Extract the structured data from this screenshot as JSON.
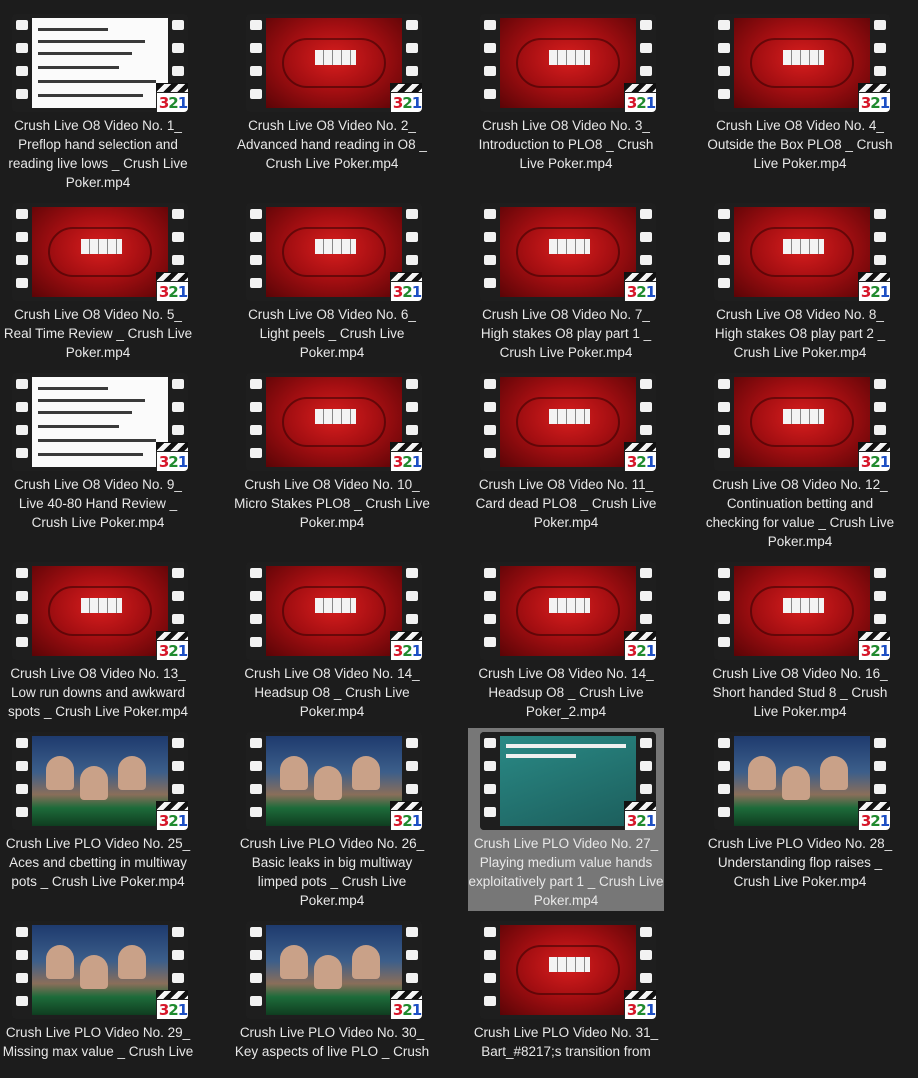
{
  "window": {
    "title": ""
  },
  "badge_text": [
    "3",
    "2",
    "1"
  ],
  "colors": {
    "background": "#1c1c1c",
    "selection": "#777777",
    "label_text": "#e8e8e8",
    "poker_felt": "#b4121a"
  },
  "files": [
    {
      "name": "Crush Live O8 Video No. 1_ Preflop hand selection and reading live lows _ Crush Live Poker.mp4",
      "thumb": "doc",
      "icon": "video-file-icon",
      "selected": false
    },
    {
      "name": "Crush Live O8 Video No. 2_ Advanced hand reading in O8 _ Crush Live Poker.mp4",
      "thumb": "poker",
      "icon": "video-file-icon",
      "selected": false
    },
    {
      "name": "Crush Live O8 Video No. 3_ Introduction to PLO8 _ Crush Live Poker.mp4",
      "thumb": "poker",
      "icon": "video-file-icon",
      "selected": false
    },
    {
      "name": "Crush Live O8 Video No. 4_ Outside the Box PLO8 _ Crush Live Poker.mp4",
      "thumb": "poker",
      "icon": "video-file-icon",
      "selected": false
    },
    {
      "name": "Crush Live O8 Video No. 5_ Real Time Review _ Crush Live Poker.mp4",
      "thumb": "poker",
      "icon": "video-file-icon",
      "selected": false
    },
    {
      "name": "Crush Live O8 Video No. 6_ Light peels _ Crush Live Poker.mp4",
      "thumb": "poker",
      "icon": "video-file-icon",
      "selected": false
    },
    {
      "name": "Crush Live O8 Video No. 7_ High stakes O8 play part 1 _ Crush Live Poker.mp4",
      "thumb": "poker",
      "icon": "video-file-icon",
      "selected": false
    },
    {
      "name": "Crush Live O8 Video No. 8_ High stakes O8 play part 2 _ Crush Live Poker.mp4",
      "thumb": "poker",
      "icon": "video-file-icon",
      "selected": false
    },
    {
      "name": "Crush Live O8 Video No. 9_ Live 40-80 Hand Review _ Crush Live Poker.mp4",
      "thumb": "doc",
      "icon": "video-file-icon",
      "selected": false
    },
    {
      "name": "Crush Live O8 Video No. 10_ Micro Stakes PLO8 _ Crush Live Poker.mp4",
      "thumb": "poker",
      "icon": "video-file-icon",
      "selected": false
    },
    {
      "name": "Crush Live O8 Video No. 11_ Card dead PLO8 _ Crush Live Poker.mp4",
      "thumb": "poker",
      "icon": "video-file-icon",
      "selected": false
    },
    {
      "name": "Crush Live O8 Video No. 12_ Continuation betting and checking for value _ Crush Live Poker.mp4",
      "thumb": "poker",
      "icon": "video-file-icon",
      "selected": false
    },
    {
      "name": "Crush Live O8 Video No. 13_ Low run downs and awkward spots _ Crush Live Poker.mp4",
      "thumb": "poker",
      "icon": "video-file-icon",
      "selected": false
    },
    {
      "name": "Crush Live O8 Video No. 14_ Headsup O8 _ Crush Live Poker.mp4",
      "thumb": "poker",
      "icon": "video-file-icon",
      "selected": false
    },
    {
      "name": "Crush Live O8 Video No. 14_ Headsup O8 _ Crush Live Poker_2.mp4",
      "thumb": "poker",
      "icon": "video-file-icon",
      "selected": false
    },
    {
      "name": "Crush Live O8 Video No. 16_ Short handed Stud 8 _ Crush Live Poker.mp4",
      "thumb": "poker",
      "icon": "video-file-icon",
      "selected": false
    },
    {
      "name": "Crush Live PLO Video No. 25_ Aces and cbetting in multiway pots _ Crush Live Poker.mp4",
      "thumb": "live",
      "icon": "video-file-icon",
      "selected": false
    },
    {
      "name": "Crush Live PLO Video No. 26_ Basic leaks in big multiway limped pots _ Crush Live Poker.mp4",
      "thumb": "live",
      "icon": "video-file-icon",
      "selected": false
    },
    {
      "name": "Crush Live PLO Video No. 27_ Playing medium value hands exploitatively part 1 _ Crush Live Poker.mp4",
      "thumb": "slide",
      "icon": "video-file-icon",
      "selected": true
    },
    {
      "name": "Crush Live PLO Video No. 28_ Understanding flop raises _ Crush Live Poker.mp4",
      "thumb": "live",
      "icon": "video-file-icon",
      "selected": false
    },
    {
      "name": "Crush Live PLO Video No. 29_ Missing max value _ Crush Live",
      "thumb": "live",
      "icon": "video-file-icon",
      "selected": false
    },
    {
      "name": "Crush Live PLO Video No. 30_ Key aspects of live PLO _ Crush",
      "thumb": "live",
      "icon": "video-file-icon",
      "selected": false
    },
    {
      "name": "Crush Live PLO Video No. 31_ Bart_#8217;s transition from",
      "thumb": "poker",
      "icon": "video-file-icon",
      "selected": false
    }
  ]
}
